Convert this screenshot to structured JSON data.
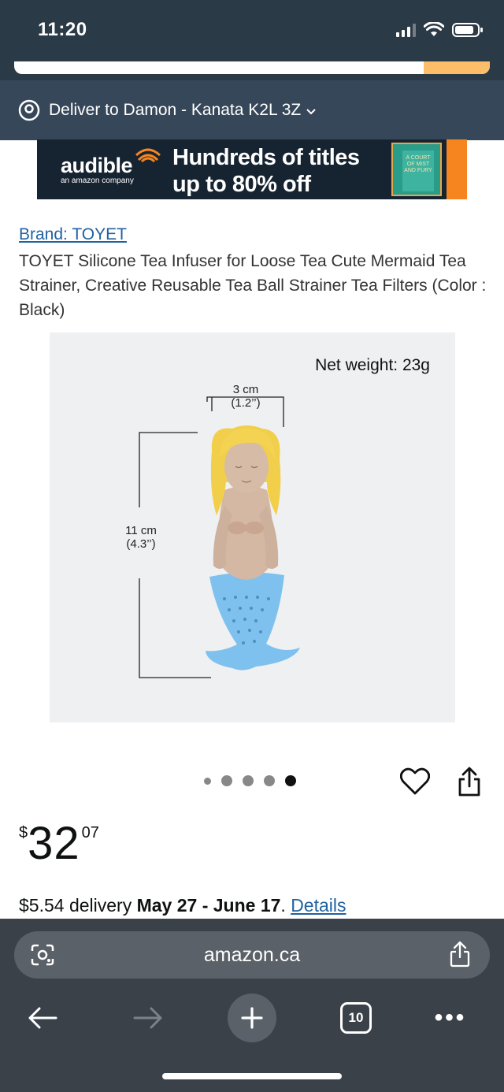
{
  "status_bar": {
    "time": "11:20"
  },
  "delivery_location": {
    "label": "Deliver to Damon - Kanata K2L 3Z",
    "icon": "location-pin-icon"
  },
  "banner": {
    "brand": "audible",
    "brand_sub": "an amazon company",
    "headline_line1": "Hundreds of titles",
    "headline_line2": "up to 80% off",
    "book_text": "A COURT OF MIST AND FURY",
    "colors": {
      "background": "#162331",
      "accent": "#f6851f"
    }
  },
  "product": {
    "brand_link": "Brand: TOYET",
    "title": "TOYET Silicone Tea Infuser for Loose Tea Cute Mermaid Tea Strainer, Creative Reusable Tea Ball Strainer Tea Filters (Color : Black)",
    "image": {
      "net_weight": "Net weight: 23g",
      "width_label_cm": "3 cm",
      "width_label_in": "(1.2’’)",
      "height_label_cm": "11 cm",
      "height_label_in": "(4.3’’)"
    },
    "carousel": {
      "count": 5,
      "active_index": 4
    },
    "price": {
      "symbol": "$",
      "whole": "32",
      "fraction": "07"
    },
    "delivery": {
      "prefix": "$5.54 delivery ",
      "dates": "May 27 - June 17",
      "separator": ". ",
      "details_link": "Details"
    }
  },
  "browser": {
    "url": "amazon.ca",
    "tab_count": "10",
    "more_label": "•••",
    "icons": [
      "google-lens-icon",
      "share-icon",
      "back-arrow-icon",
      "forward-arrow-icon",
      "new-tab-plus-icon",
      "tab-switcher-icon",
      "more-menu-icon"
    ]
  }
}
